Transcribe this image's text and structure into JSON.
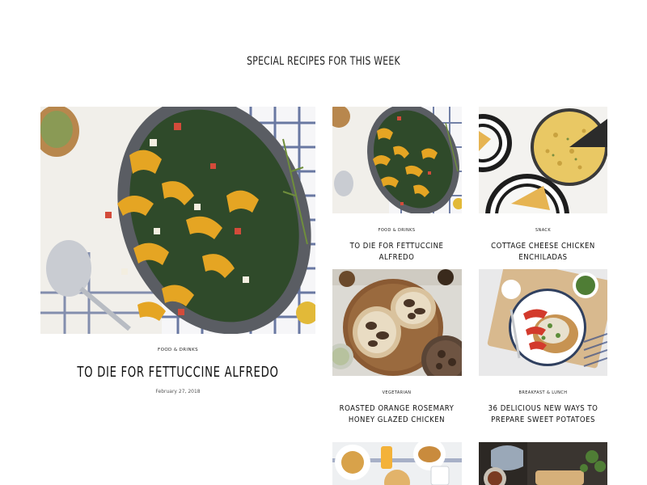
{
  "section": {
    "title": "SPECIAL RECIPES FOR THIS WEEK"
  },
  "featured": {
    "category": "FOOD & DRINKS",
    "title": "TO DIE FOR FETTUCCINE ALFREDO",
    "date": "February 27, 2018"
  },
  "cards": [
    {
      "category": "FOOD & DRINKS",
      "title": "TO DIE FOR FETTUCCINE ALFREDO"
    },
    {
      "category": "SNACK",
      "title": "COTTAGE CHEESE CHICKEN ENCHILADAS"
    },
    {
      "category": "VEGETARIAN",
      "title": "ROASTED ORANGE ROSEMARY HONEY GLAZED CHICKEN"
    },
    {
      "category": "BREAKFAST & LUNCH",
      "title": "36 DELICIOUS NEW WAYS TO PREPARE SWEET POTATOES"
    }
  ]
}
